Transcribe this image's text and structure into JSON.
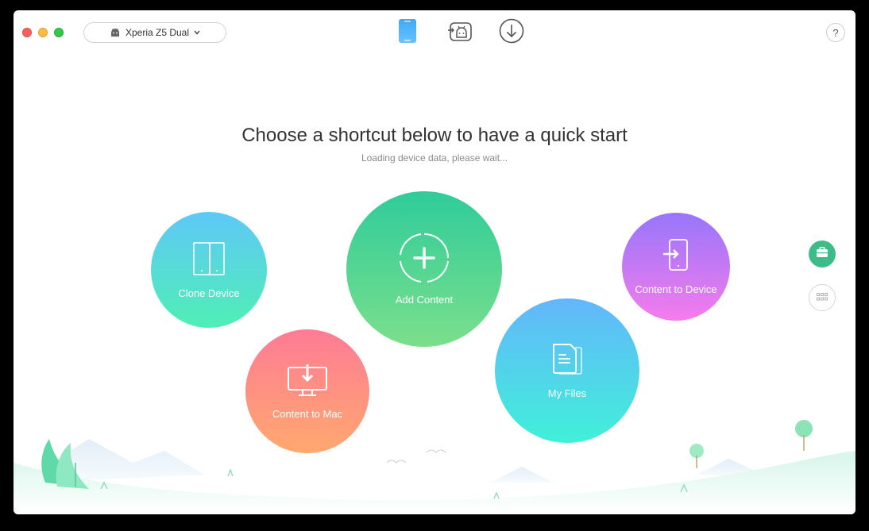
{
  "toolbar": {
    "device_name": "Xperia Z5 Dual",
    "icons": [
      "phone-icon",
      "android-transfer-icon",
      "download-icon"
    ],
    "help_label": "?"
  },
  "main": {
    "headline": "Choose a shortcut below to have a quick start",
    "status": "Loading device data, please wait..."
  },
  "shortcuts": {
    "clone": "Clone Device",
    "add": "Add Content",
    "mac": "Content to Mac",
    "files": "My Files",
    "device": "Content to Device"
  },
  "colors": {
    "clone": [
      "#5fc8f8",
      "#4fefb5"
    ],
    "add": [
      "#2fcc9a",
      "#7bdf8c"
    ],
    "mac": [
      "#fe7b95",
      "#ffa86f"
    ],
    "files": [
      "#63b6fb",
      "#40f0d9"
    ],
    "device": [
      "#9776fb",
      "#f57cec"
    ],
    "active_tab": "#3fa9f5",
    "tool_button": "#3dbc8a"
  }
}
